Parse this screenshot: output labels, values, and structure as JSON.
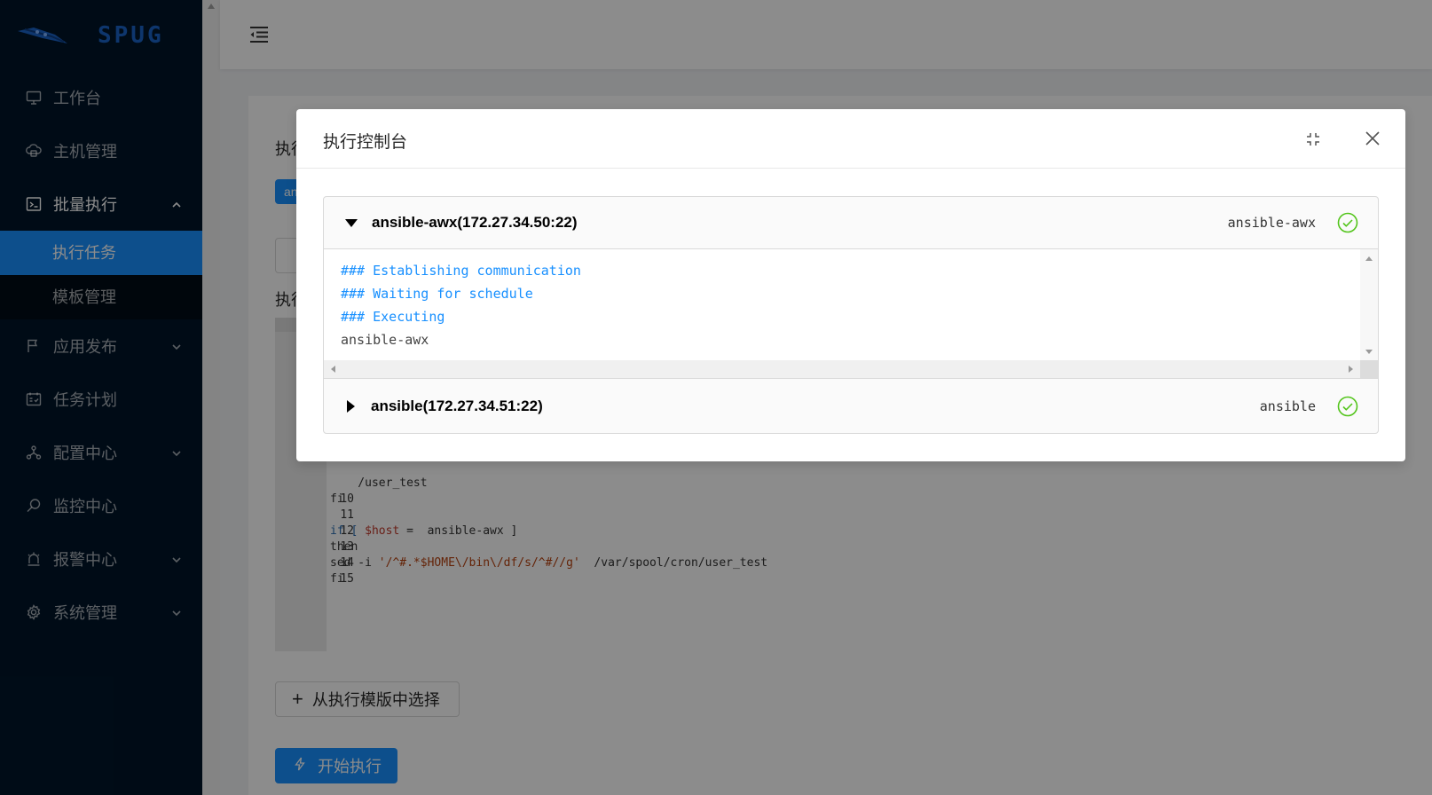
{
  "brand": {
    "name": "SPUG"
  },
  "sidebar": {
    "items": [
      {
        "label": "工作台",
        "icon": "desktop-icon"
      },
      {
        "label": "主机管理",
        "icon": "cloud-server-icon"
      },
      {
        "label": "批量执行",
        "icon": "code-terminal-icon",
        "expanded": true,
        "children": [
          {
            "label": "执行任务",
            "active": true
          },
          {
            "label": "模板管理"
          }
        ]
      },
      {
        "label": "应用发布",
        "icon": "flag-icon"
      },
      {
        "label": "任务计划",
        "icon": "schedule-icon"
      },
      {
        "label": "配置中心",
        "icon": "deployment-icon"
      },
      {
        "label": "监控中心",
        "icon": "monitor-search-icon"
      },
      {
        "label": "报警中心",
        "icon": "alert-icon"
      },
      {
        "label": "系统管理",
        "icon": "setting-icon"
      }
    ]
  },
  "page": {
    "section_label_1": "执行",
    "tag_text": "an",
    "section_label_2": "执行",
    "code_lines": [
      {
        "num": "",
        "text": "    /user_test"
      },
      {
        "num": "10",
        "text": "fi"
      },
      {
        "num": "11",
        "text": ""
      },
      {
        "num": "12",
        "pre": "if [ ",
        "var": "$host",
        "post": " =  ansible-awx ]"
      },
      {
        "num": "13",
        "text": "then"
      },
      {
        "num": "14",
        "pre": "sed -i ",
        "str": "'/^#.*$HOME\\/bin\\/df/s/^#//g'",
        "post": "  /var/spool/cron/user_test"
      },
      {
        "num": "15",
        "text": "fi"
      }
    ],
    "template_button": "从执行模版中选择",
    "run_button": "开始执行"
  },
  "modal": {
    "title": "执行控制台",
    "panels": [
      {
        "host": "ansible-awx(172.27.34.50:22)",
        "name": "ansible-awx",
        "expanded": true,
        "status": "success",
        "output": [
          {
            "text": "### Establishing communication",
            "kind": "info"
          },
          {
            "text": "### Waiting for schedule",
            "kind": "info"
          },
          {
            "text": "### Executing",
            "kind": "info"
          },
          {
            "text": "ansible-awx",
            "kind": "plain"
          }
        ]
      },
      {
        "host": "ansible(172.27.34.51:22)",
        "name": "ansible",
        "expanded": false,
        "status": "success"
      }
    ]
  },
  "colors": {
    "sidebar_bg": "#001529",
    "primary": "#1890ff",
    "success": "#52c41a"
  }
}
